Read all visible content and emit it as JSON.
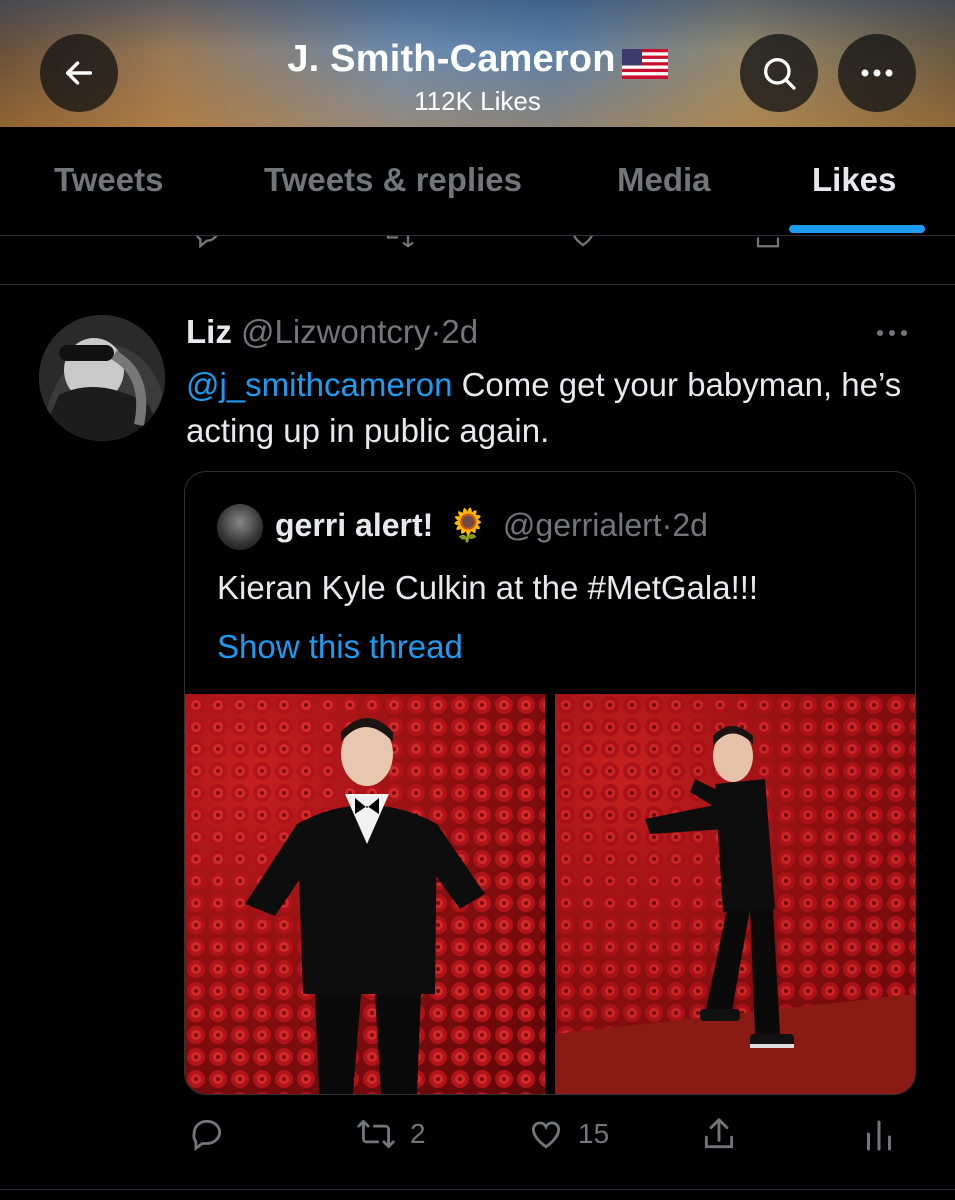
{
  "header": {
    "title": "J. Smith-Cameron",
    "flag_icon": "us-flag-icon",
    "subtitle": "112K Likes"
  },
  "tabs": [
    {
      "label": "Tweets",
      "active": false
    },
    {
      "label": "Tweets & replies",
      "active": false
    },
    {
      "label": "Media",
      "active": false
    },
    {
      "label": "Likes",
      "active": true
    }
  ],
  "tweet": {
    "display_name": "Liz",
    "handle": "@Lizwontcry",
    "separator": "·",
    "time": "2d",
    "mention": "@j_smithcameron",
    "text": " Come get your babyman, he’s acting up in public again.",
    "quote": {
      "display_name": "gerri alert!",
      "emoji": "🌻",
      "handle": "@gerrialert",
      "separator": "·",
      "time": "2d",
      "text": "Kieran Kyle Culkin at the #MetGala!!!",
      "link": "Show this thread"
    },
    "actions": {
      "reply_count": "",
      "retweet_count": "2",
      "like_count": "15"
    }
  },
  "colors": {
    "accent": "#1d9bf0",
    "background": "#000000",
    "muted": "#71767b",
    "text": "#e7e9ea",
    "border": "#2f3336"
  }
}
